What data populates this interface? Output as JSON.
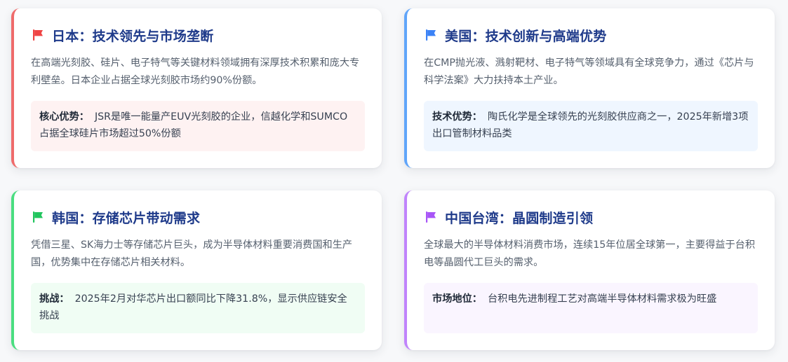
{
  "cards": [
    {
      "title": "日本：技术领先与市场垄断",
      "icon": "flag-icon",
      "accent": "#ef6b6b",
      "flag_color": "#ef4444",
      "tint": "#fef2f2",
      "description": "在高端光刻胶、硅片、电子特气等关键材料领域拥有深厚技术积累和庞大专利壁垒。日本企业占据全球光刻胶市场约90%份额。",
      "callout_label": "核心优势：",
      "callout_text": "JSR是唯一能量产EUV光刻胶的企业，信越化学和SUMCO占据全球硅片市场超过50%份额"
    },
    {
      "title": "美国：技术创新与高端优势",
      "icon": "flag-icon",
      "accent": "#60a5fa",
      "flag_color": "#3b82f6",
      "tint": "#eff6ff",
      "description": "在CMP抛光液、溅射靶材、电子特气等领域具有全球竞争力，通过《芯片与科学法案》大力扶持本土产业。",
      "callout_label": "技术优势：",
      "callout_text": "陶氏化学是全球领先的光刻胶供应商之一，2025年新增3项出口管制材料品类"
    },
    {
      "title": "韩国：存储芯片带动需求",
      "icon": "flag-icon",
      "accent": "#4ade80",
      "flag_color": "#22c55e",
      "tint": "#f0fdf4",
      "description": "凭借三星、SK海力士等存储芯片巨头，成为半导体材料重要消费国和生产国，优势集中在存储芯片相关材料。",
      "callout_label": "挑战：",
      "callout_text": "2025年2月对华芯片出口额同比下降31.8%，显示供应链安全挑战"
    },
    {
      "title": "中国台湾：晶圆制造引领",
      "icon": "flag-icon",
      "accent": "#c084fc",
      "flag_color": "#a855f7",
      "tint": "#faf5ff",
      "description": "全球最大的半导体材料消费市场，连续15年位居全球第一，主要得益于台积电等晶圆代工巨头的需求。",
      "callout_label": "市场地位：",
      "callout_text": "台积电先进制程工艺对高端半导体材料需求极为旺盛"
    }
  ]
}
